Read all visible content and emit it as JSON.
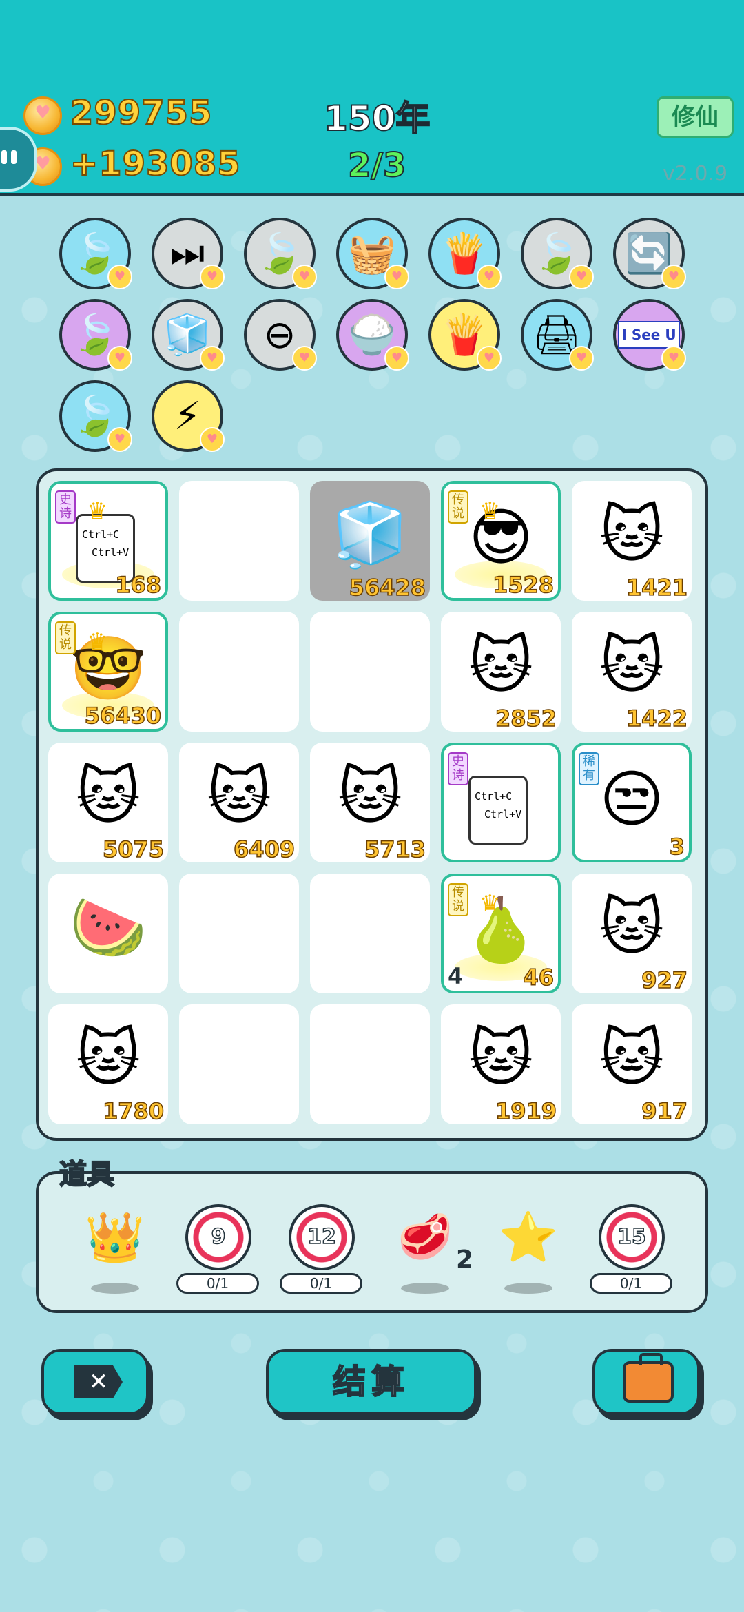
{
  "header": {
    "coins": "299755",
    "income": "+193085",
    "year": "150年",
    "progress": "2/3",
    "mode_label": "修仙",
    "version": "v2.0.9"
  },
  "skills": [
    {
      "icon": "🍃",
      "name": "leaf-skill",
      "color": "blue"
    },
    {
      "icon": "⏭",
      "name": "skip-skill",
      "color": "grey"
    },
    {
      "icon": "🍃",
      "name": "leaf-skill",
      "color": "grey"
    },
    {
      "icon": "🧺",
      "name": "basket-skill",
      "color": "blue"
    },
    {
      "icon": "🍟",
      "name": "fries-skill",
      "color": "blue"
    },
    {
      "icon": "🍃",
      "name": "leaf-skill",
      "color": "grey"
    },
    {
      "icon": "🔄",
      "name": "refresh-skill",
      "color": "grey"
    },
    {
      "icon": "🍃",
      "name": "leaf-skill",
      "color": "purple"
    },
    {
      "icon": "🧊",
      "name": "cubes-skill",
      "color": "grey"
    },
    {
      "icon": "⊖",
      "name": "minus-skill",
      "color": "grey"
    },
    {
      "icon": "🍚",
      "name": "rice-skill",
      "color": "purple"
    },
    {
      "icon": "🍟",
      "name": "fries-skill",
      "color": "yellow"
    },
    {
      "icon": "🖨",
      "name": "printer-skill",
      "color": "blue"
    },
    {
      "icon": "I See U",
      "name": "i-see-u-skill",
      "color": "purple"
    },
    {
      "icon": "🍃",
      "name": "leaf-skill",
      "color": "blue"
    },
    {
      "icon": "⚡",
      "name": "lightning-skill",
      "color": "yellow"
    }
  ],
  "board": [
    {
      "icon": "copy",
      "value": "168",
      "tag": "史诗",
      "rarity": "epic",
      "crown": true
    },
    {
      "icon": "",
      "value": ""
    },
    {
      "icon": "🧊",
      "value": "56428",
      "grey": true
    },
    {
      "icon": "😎",
      "value": "1528",
      "tag": "传说",
      "rarity": "legend",
      "crown": true
    },
    {
      "icon": "🐱",
      "value": "1421"
    },
    {
      "icon": "🤓",
      "value": "56430",
      "tag": "传说",
      "rarity": "legend",
      "crown": true
    },
    {
      "icon": "",
      "value": ""
    },
    {
      "icon": "",
      "value": ""
    },
    {
      "icon": "🐱",
      "value": "2852"
    },
    {
      "icon": "🐱",
      "value": "1422"
    },
    {
      "icon": "🐱",
      "value": "5075"
    },
    {
      "icon": "🐱",
      "value": "6409"
    },
    {
      "icon": "🐱",
      "value": "5713"
    },
    {
      "icon": "copy",
      "value": "",
      "tag": "史诗",
      "rarity": "epic"
    },
    {
      "icon": "😒",
      "value": "3",
      "tag": "稀有",
      "rarity": "rare"
    },
    {
      "icon": "🍉",
      "value": ""
    },
    {
      "icon": "",
      "value": ""
    },
    {
      "icon": "",
      "value": ""
    },
    {
      "icon": "🍐",
      "value": "46",
      "left_value": "4",
      "tag": "传说",
      "rarity": "legend",
      "crown": true
    },
    {
      "icon": "🐱",
      "value": "927"
    },
    {
      "icon": "🐱",
      "value": "1780"
    },
    {
      "icon": "",
      "value": ""
    },
    {
      "icon": "",
      "value": ""
    },
    {
      "icon": "🐱",
      "value": "1919"
    },
    {
      "icon": "🐱",
      "value": "917"
    }
  ],
  "copy_card": {
    "line1": "Ctrl+C",
    "line2": "Ctrl+V"
  },
  "props": {
    "title": "道具",
    "items": [
      {
        "type": "crown",
        "icon": "👑"
      },
      {
        "type": "target",
        "label": "9",
        "count": "0/1"
      },
      {
        "type": "target",
        "label": "12",
        "count": "0/1"
      },
      {
        "type": "meat",
        "icon": "🥩",
        "count": "2"
      },
      {
        "type": "star",
        "icon": "⭐"
      },
      {
        "type": "target",
        "label": "15",
        "count": "0/1"
      }
    ]
  },
  "buttons": {
    "close": "✕",
    "settle": "结算",
    "bag": ""
  },
  "colors": {
    "header": "#19c3c6",
    "background": "#acdfe6",
    "accent": "#1fc5c6",
    "coin_text": "#ffd23a"
  }
}
